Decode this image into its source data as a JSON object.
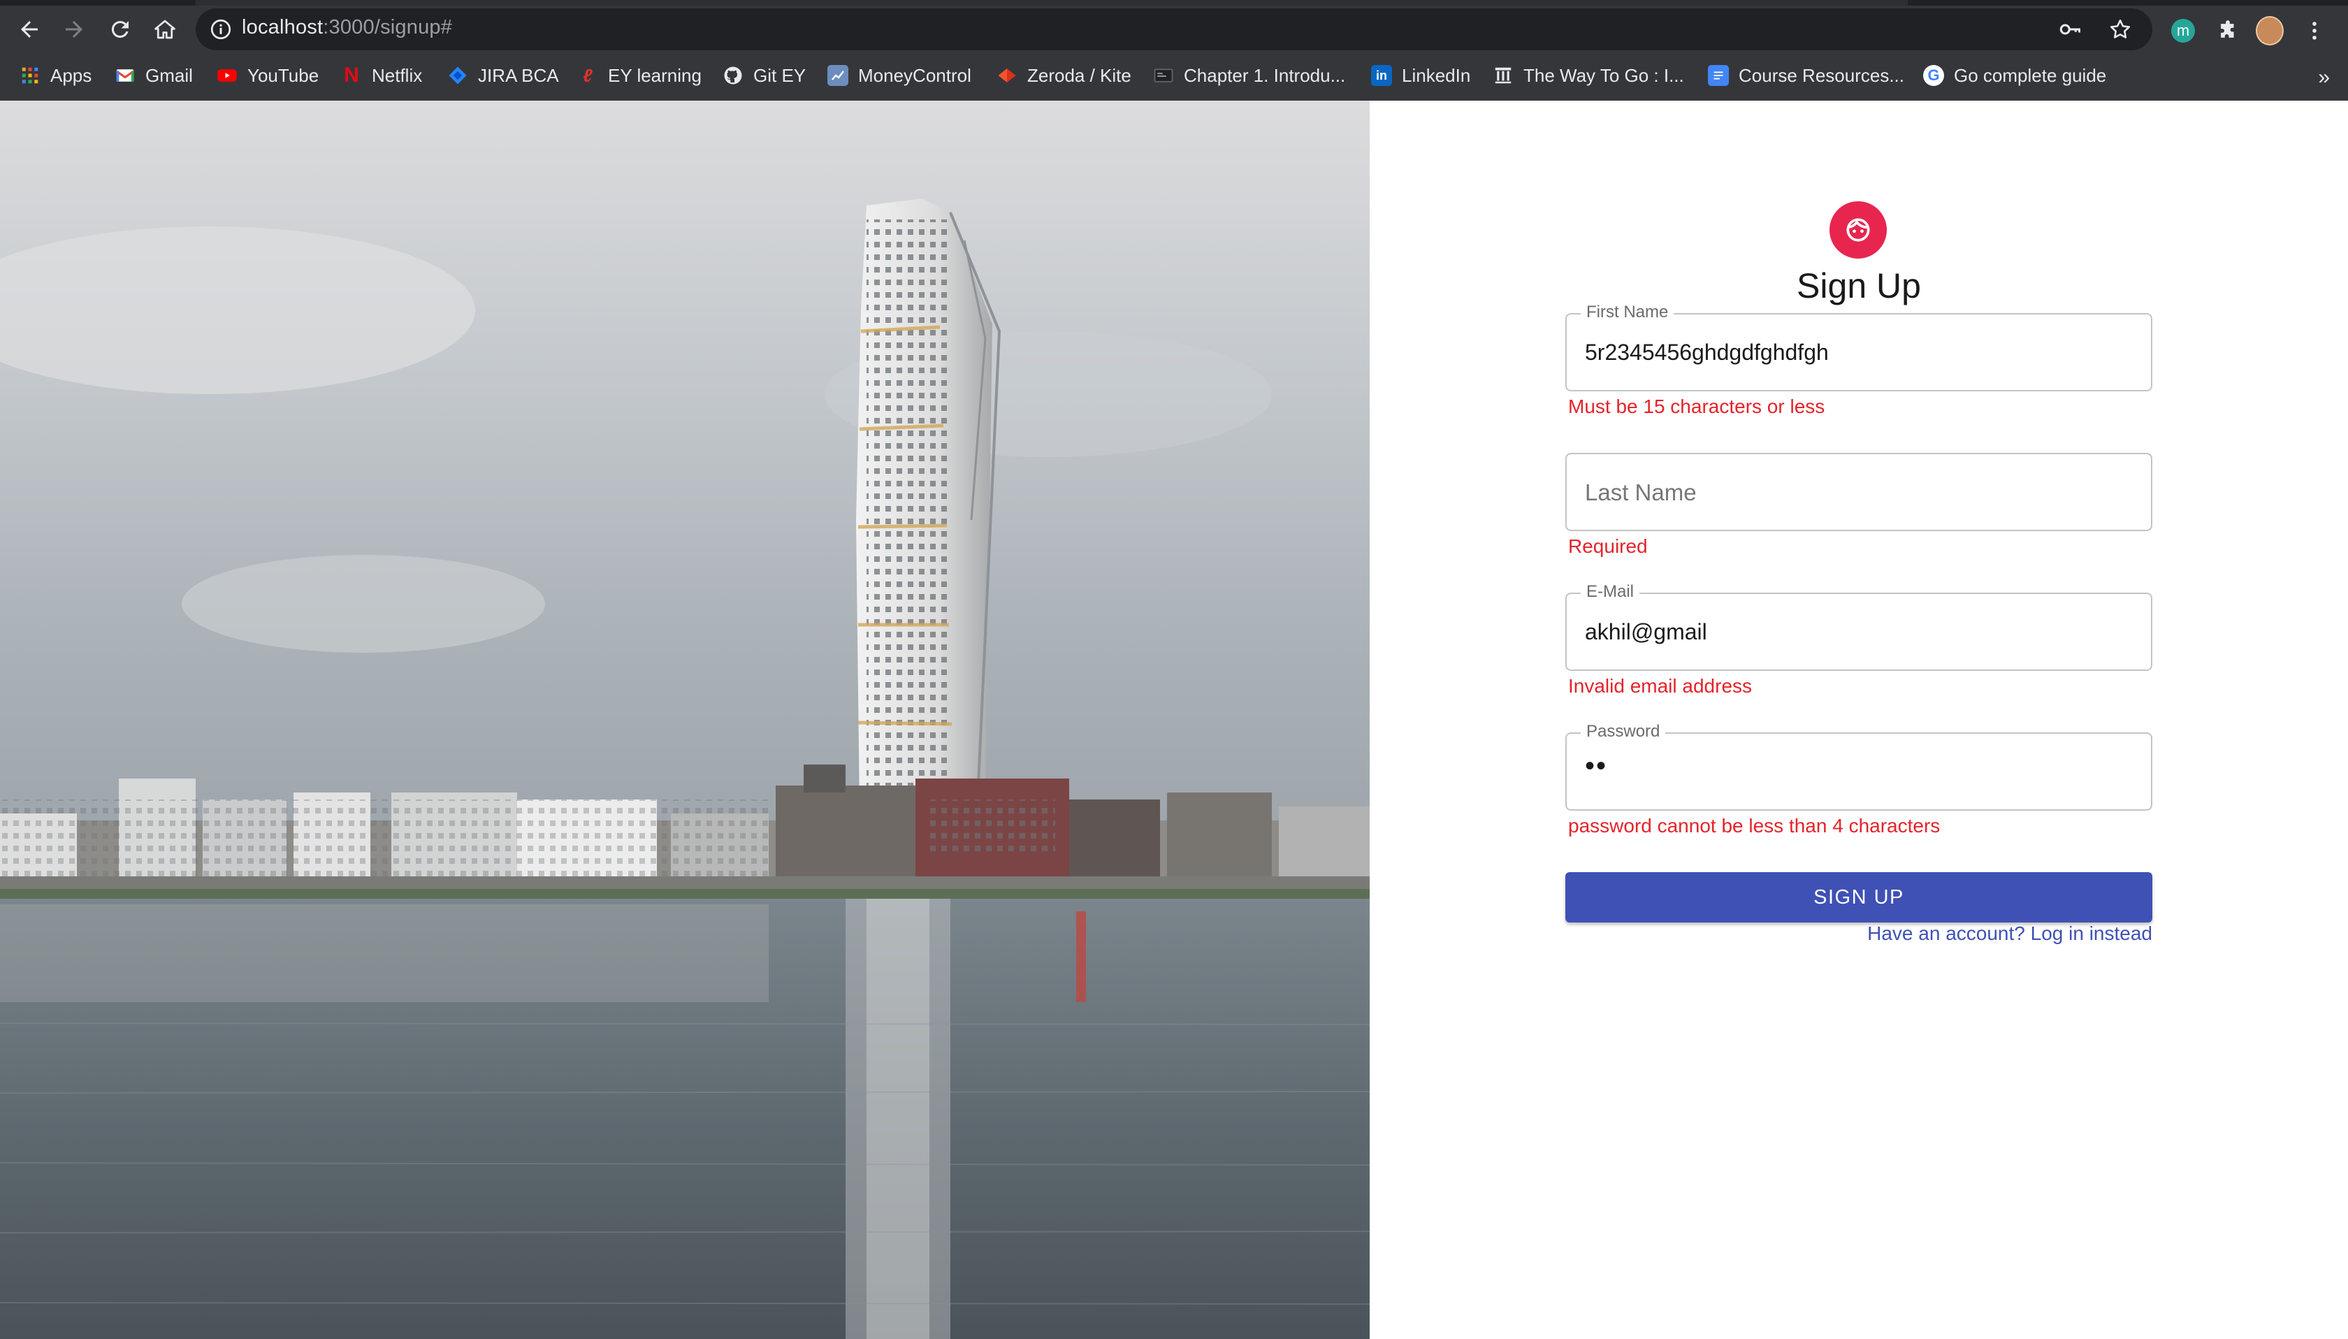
{
  "browser": {
    "url_host": "localhost",
    "url_rest": ":3000/signup#",
    "bookmarks": [
      {
        "label": "Apps",
        "icon": "apps-grid-icon",
        "color": "#e8eaed"
      },
      {
        "label": "Gmail",
        "icon": "gmail-icon",
        "color": "#ea4335"
      },
      {
        "label": "YouTube",
        "icon": "youtube-icon",
        "color": "#ff0000"
      },
      {
        "label": "Netflix",
        "icon": "netflix-icon",
        "color": "#e50914"
      },
      {
        "label": "JIRA BCA",
        "icon": "jira-icon",
        "color": "#2684ff"
      },
      {
        "label": "EY learning",
        "icon": "ey-learning-icon",
        "color": "#e4302b"
      },
      {
        "label": "Git EY",
        "icon": "github-icon",
        "color": "#e8eaed"
      },
      {
        "label": "MoneyControl",
        "icon": "moneycontrol-icon",
        "color": "#6c8ebf"
      },
      {
        "label": "Zeroda / Kite",
        "icon": "kite-icon",
        "color": "#f2542d"
      },
      {
        "label": "Chapter 1. Introdu...",
        "icon": "page-icon",
        "color": "#5f6368"
      },
      {
        "label": "LinkedIn",
        "icon": "linkedin-icon",
        "color": "#0a66c2"
      },
      {
        "label": "The Way To Go : I...",
        "icon": "building-icon",
        "color": "#e8eaed"
      },
      {
        "label": "Course Resources...",
        "icon": "docs-icon",
        "color": "#4285f4"
      },
      {
        "label": "Go complete guide",
        "icon": "google-icon",
        "color": "#4285f4"
      }
    ],
    "more_label": "»"
  },
  "form": {
    "title": "Sign Up",
    "first_name": {
      "label": "First Name",
      "value": "5r2345456ghdgdfghdfgh",
      "error": "Must be 15 characters or less"
    },
    "last_name": {
      "placeholder": "Last Name",
      "error": "Required"
    },
    "email": {
      "label": "E-Mail",
      "value": "akhil@gmail",
      "error": "Invalid email address"
    },
    "password": {
      "label": "Password",
      "value": "••",
      "error": "password cannot be less than 4 characters"
    },
    "submit_label": "SIGN UP",
    "login_link": "Have an account? Log in instead"
  },
  "colors": {
    "accent": "#3f51b5",
    "error": "#e4232b",
    "avatar": "#e8254e"
  }
}
